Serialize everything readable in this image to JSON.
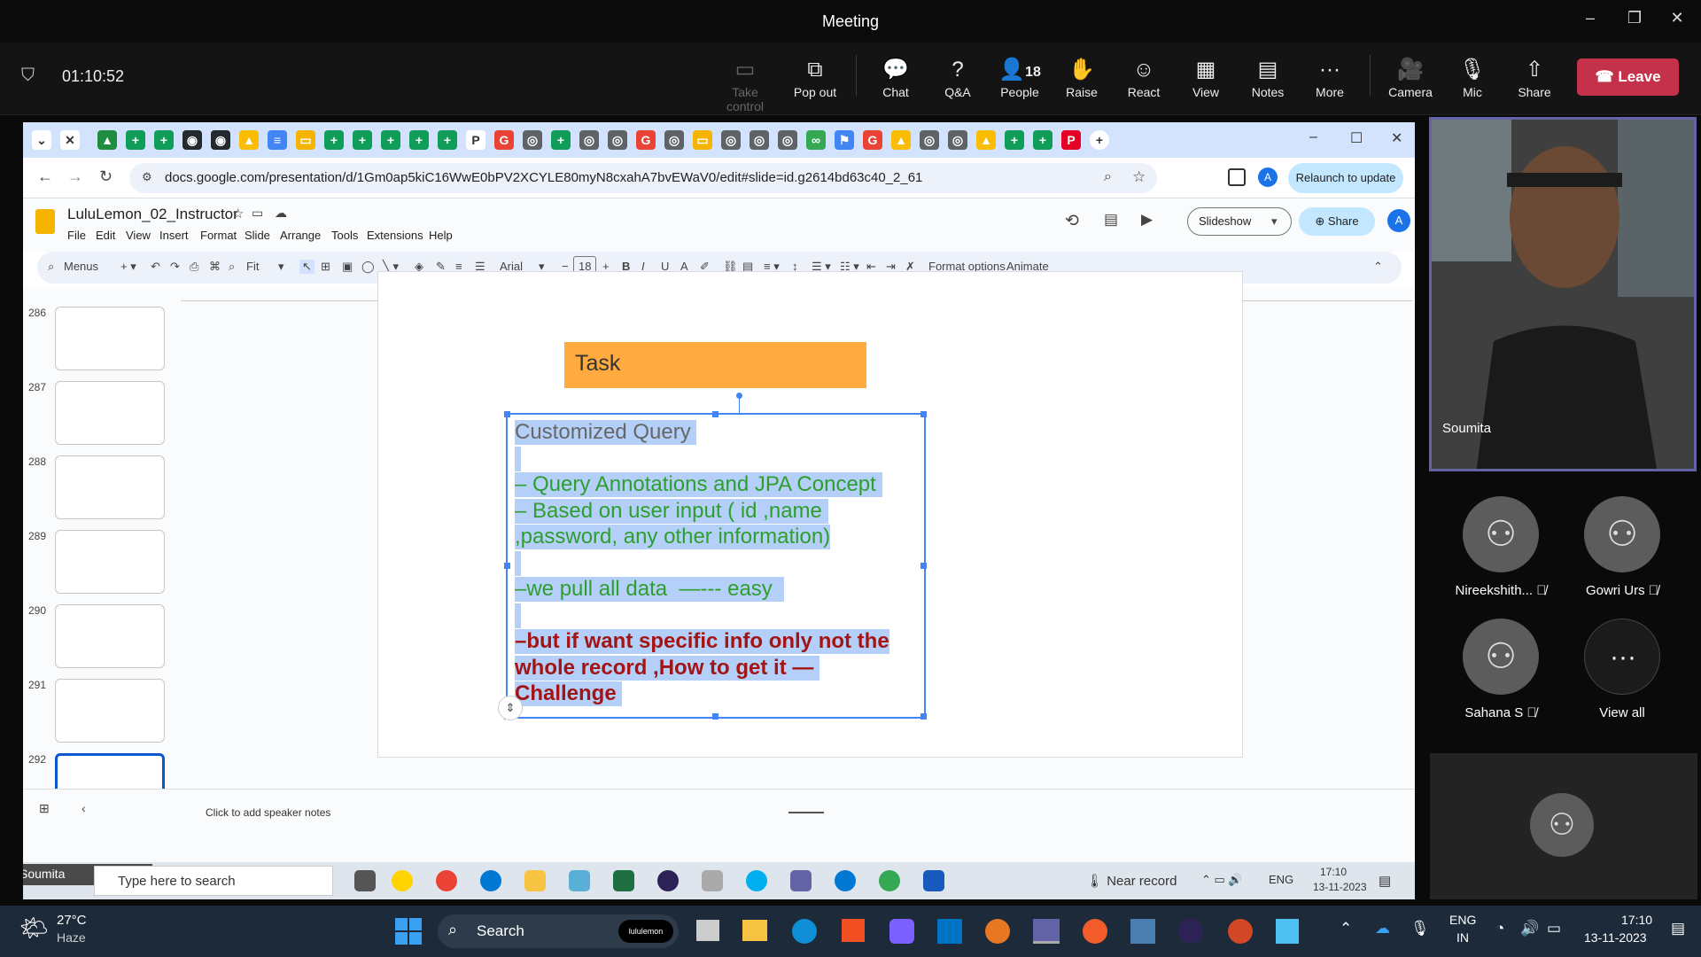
{
  "window": {
    "title": "Meeting"
  },
  "meeting": {
    "timer": "01:10:52",
    "buttons": {
      "take_control": "Take control",
      "pop_out": "Pop out",
      "chat": "Chat",
      "qa": "Q&A",
      "people": "People",
      "people_count": "18",
      "raise": "Raise",
      "react": "React",
      "view": "View",
      "notes": "Notes",
      "more": "More",
      "camera": "Camera",
      "mic": "Mic",
      "share": "Share",
      "leave": "Leave"
    }
  },
  "browser": {
    "url": "docs.google.com/presentation/d/1Gm0ap5kiC16WwE0bPV2XCYLE80myN8cxahA7bvEWaV0/edit#slide=id.g2614bd63c40_2_61",
    "relaunch": "Relaunch to update",
    "profile_letter": "A"
  },
  "slides_app": {
    "doc_title": "LuluLemon_02_Instructor",
    "menus": [
      "File",
      "Edit",
      "View",
      "Insert",
      "Format",
      "Slide",
      "Arrange",
      "Tools",
      "Extensions",
      "Help"
    ],
    "slideshow": "Slideshow",
    "share": "Share",
    "account_letter": "A",
    "toolbar": {
      "menus": "Menus",
      "zoom": "Fit",
      "font": "Arial",
      "font_size": "18",
      "format_options": "Format options",
      "animate": "Animate"
    },
    "thumbnails": [
      "286",
      "287",
      "288",
      "289",
      "290",
      "291",
      "292"
    ],
    "slide": {
      "title": "Task",
      "lines": [
        {
          "text": "Customized Query ",
          "color": "#666666"
        },
        {
          "text": " ",
          "color": "#666666"
        },
        {
          "text": "– Query Annotations and JPA Concept ",
          "color": "#2e9e2e"
        },
        {
          "text": "– Based on user input ( id ,name ",
          "color": "#2e9e2e"
        },
        {
          "text": ",password, any other information)",
          "color": "#2e9e2e"
        },
        {
          "text": " ",
          "color": "#2e9e2e"
        },
        {
          "text": "–we pull all data  —--- easy  ",
          "color": "#2e9e2e"
        },
        {
          "text": " ",
          "color": "#2e9e2e"
        },
        {
          "text": "–but if want specific info only not the",
          "color": "#a31515",
          "bold": true
        },
        {
          "text": "whole record ,How to get it — ",
          "color": "#a31515",
          "bold": true
        },
        {
          "text": "Challenge ",
          "color": "#a31515",
          "bold": true
        }
      ]
    },
    "speaker_notes": "Click to add speaker notes"
  },
  "inner_taskbar": {
    "presenter": "Soumita",
    "search_placeholder": "Type here to search",
    "near_record": "Near record",
    "lang": "ENG",
    "time": "17:10",
    "date": "13-11-2023"
  },
  "participants": {
    "main": "Soumita",
    "others": [
      {
        "name": "Nireekshith...",
        "muted": true
      },
      {
        "name": "Gowri Urs",
        "muted": true
      },
      {
        "name": "Sahana S",
        "muted": true
      }
    ],
    "view_all": "View all"
  },
  "windows_taskbar": {
    "weather_temp": "27°C",
    "weather_desc": "Haze",
    "search": "Search",
    "search_badge": "lululemon",
    "lang1": "ENG",
    "lang2": "IN",
    "time": "17:10",
    "date": "13-11-2023"
  }
}
